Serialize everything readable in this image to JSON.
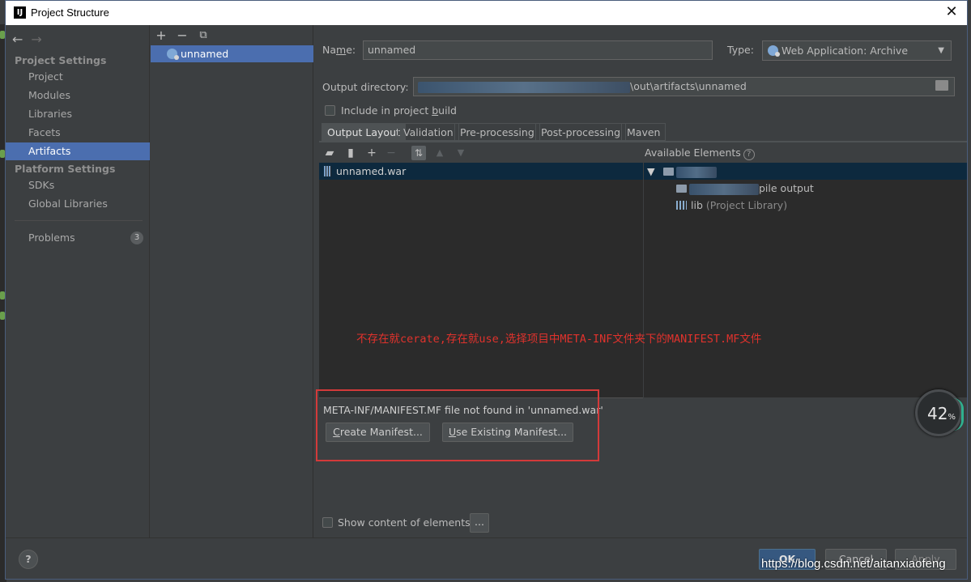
{
  "window": {
    "title": "Project Structure",
    "app_icon": "intellij-icon"
  },
  "nav": {
    "project_settings_header": "Project Settings",
    "project_items": [
      "Project",
      "Modules",
      "Libraries",
      "Facets",
      "Artifacts"
    ],
    "platform_settings_header": "Platform Settings",
    "platform_items": [
      "SDKs",
      "Global Libraries"
    ],
    "problems_label": "Problems",
    "problems_count": "3",
    "selected": "Artifacts"
  },
  "artifacts": {
    "toolbar": [
      "add-icon",
      "remove-icon",
      "copy-icon"
    ],
    "items": [
      "unnamed"
    ]
  },
  "form": {
    "name_label_prefix": "Na",
    "name_label_underlined": "m",
    "name_label_suffix": "e:",
    "name_value": "unnamed",
    "type_label": "Type:",
    "type_value": "Web Application: Archive",
    "output_dir_label": "Output directory:",
    "output_dir_value": "\\out\\artifacts\\unnamed",
    "include_label_prefix": "Include in project ",
    "include_label_underlined": "b",
    "include_label_suffix": "uild",
    "include_checked": false
  },
  "tabs": [
    "Output Layout",
    "Validation",
    "Pre-processing",
    "Post-processing",
    "Maven"
  ],
  "active_tab": "Output Layout",
  "layout": {
    "available_label": "Available Elements",
    "left_tree": [
      "unnamed.war"
    ],
    "right_tree": {
      "row2_suffix": "pile output",
      "lib_name": "lib",
      "lib_note": "(Project Library)"
    }
  },
  "annotation": "不存在就cerate,存在就use,选择项目中META-INF文件夹下的MANIFEST.MF文件",
  "manifest": {
    "message": "META-INF/MANIFEST.MF file not found in 'unnamed.war'",
    "create_prefix": "",
    "create_underlined": "C",
    "create_suffix": "reate Manifest...",
    "use_underlined": "U",
    "use_suffix": "se Existing Manifest..."
  },
  "show_content": {
    "label": "Show content of elements",
    "ellipsis": "...",
    "checked": false
  },
  "bottom": {
    "help": "?",
    "ok": "OK",
    "cancel": "Cancel",
    "apply": "Apply"
  },
  "watermark": "https://blog.csdn.net/aitanxiaofeng",
  "perf_widget": {
    "value": "42",
    "unit": "%"
  },
  "colors": {
    "accent": "#4b6eaf",
    "annotation": "#e0322c",
    "highlight_box": "#d33a3a"
  }
}
